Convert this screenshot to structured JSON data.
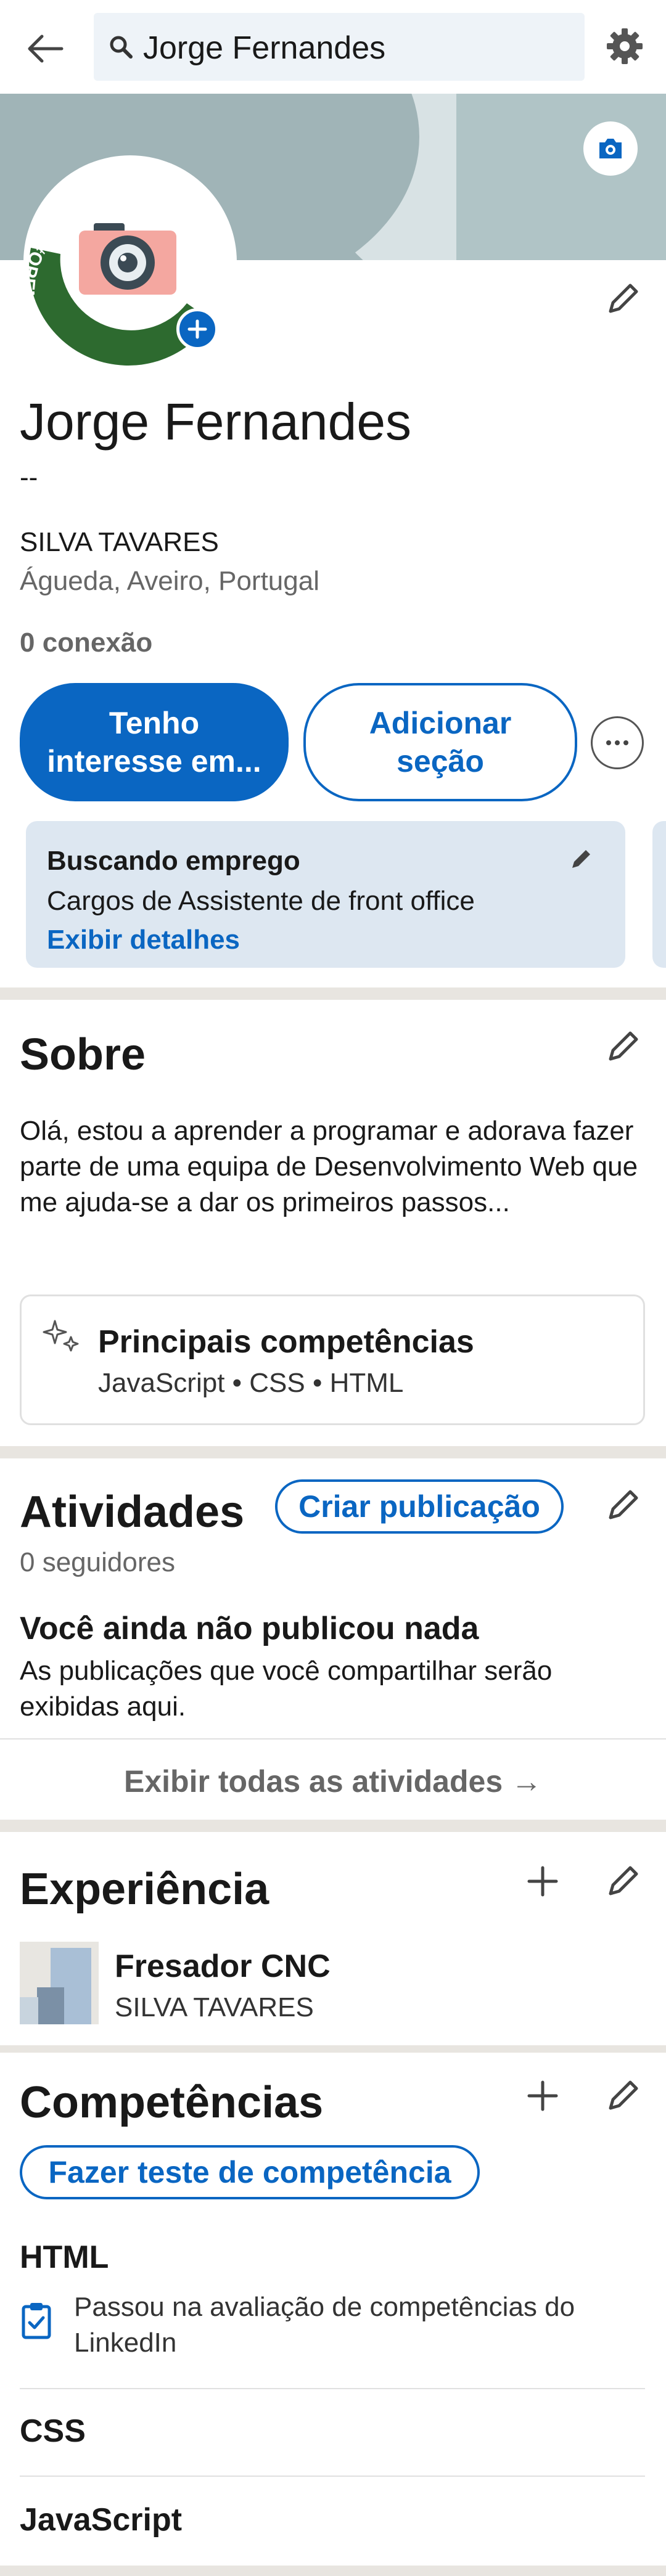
{
  "header": {
    "search_value": "Jorge Fernandes"
  },
  "profile": {
    "name": "Jorge Fernandes",
    "headline": "--",
    "company": "SILVA TAVARES",
    "location": "Águeda, Aveiro, Portugal",
    "connections": "0 conexão",
    "open_to_work_badge": "#OPENTOWORK"
  },
  "actions": {
    "primary_label": "Tenho interesse em...",
    "secondary_label": "Adicionar seção"
  },
  "job_card": {
    "title": "Buscando emprego",
    "roles": "Cargos de Assistente de front office",
    "link": "Exibir detalhes"
  },
  "about": {
    "title": "Sobre",
    "text": "Olá, estou a aprender a programar e adorava fazer parte de uma equipa de Desenvolvimento Web que me ajuda-se a dar os primeiros passos...",
    "skills_title": "Principais competências",
    "skills_list": "JavaScript • CSS • HTML"
  },
  "activity": {
    "title": "Atividades",
    "create_post": "Criar publicação",
    "followers": "0 seguidores",
    "empty_title": "Você ainda não publicou nada",
    "empty_text": "As publicações que você compartilhar serão exibidas aqui.",
    "show_all": "Exibir todas as atividades →"
  },
  "experience": {
    "title": "Experiência",
    "items": [
      {
        "role": "Fresador CNC",
        "company": "SILVA TAVARES"
      }
    ]
  },
  "skills": {
    "title": "Competências",
    "test_button": "Fazer teste de competência",
    "items": [
      {
        "name": "HTML",
        "badge": "Passou na avaliação de competências do LinkedIn"
      },
      {
        "name": "CSS"
      },
      {
        "name": "JavaScript"
      }
    ]
  },
  "colors": {
    "accent": "#0a66c2",
    "banner": "#a0b4b7",
    "open_to_work_green": "#2d6a2f",
    "job_card_bg": "#dde7f1",
    "divider": "#e8e5e0"
  },
  "icons": [
    "back-arrow-icon",
    "search-icon",
    "settings-gear-icon",
    "camera-icon",
    "pencil-icon",
    "plus-icon",
    "more-icon",
    "sparkle-icon",
    "verified-clipboard-icon"
  ]
}
